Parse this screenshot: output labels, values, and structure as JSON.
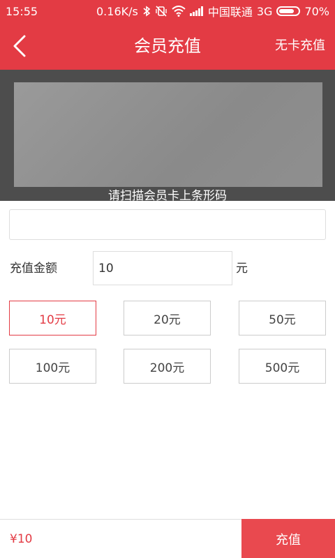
{
  "status_bar": {
    "time": "15:55",
    "net_speed": "0.16K/s",
    "carrier": "中国联通",
    "network": "3G",
    "battery": "70%"
  },
  "header": {
    "title": "会员充值",
    "right_action": "无卡充值"
  },
  "scanner": {
    "hint": "请扫描会员卡上条形码"
  },
  "barcode_field": {
    "value": ""
  },
  "amount": {
    "label": "充值金额",
    "value": "10",
    "unit": "元"
  },
  "options": [
    {
      "label": "10元",
      "selected": true
    },
    {
      "label": "20元",
      "selected": false
    },
    {
      "label": "50元",
      "selected": false
    },
    {
      "label": "100元",
      "selected": false
    },
    {
      "label": "200元",
      "selected": false
    },
    {
      "label": "500元",
      "selected": false
    }
  ],
  "footer": {
    "total": "¥10",
    "submit_label": "充值"
  },
  "colors": {
    "brand": "#e33b44",
    "submit": "#e9494f"
  }
}
